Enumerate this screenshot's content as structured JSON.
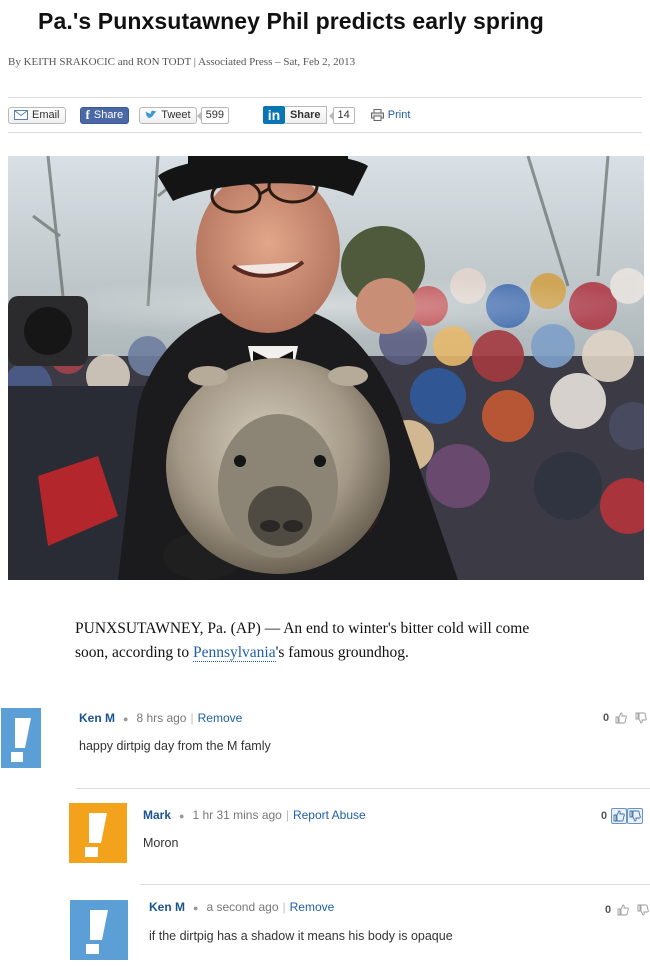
{
  "article": {
    "headline": "Pa.'s Punxsutawney Phil predicts early spring",
    "byline": "By KEITH SRAKOCIC and RON TODT | Associated Press – Sat, Feb 2, 2013",
    "lead_before": "PUNXSUTAWNEY, Pa. (AP) — An end to winter's bitter cold will come soon, according to ",
    "lead_link": "Pennsylvania",
    "lead_after": "'s famous groundhog."
  },
  "share": {
    "email_label": "Email",
    "facebook_label": "Share",
    "tweet_label": "Tweet",
    "tweet_count": "599",
    "linkedin_label": "Share",
    "linkedin_count": "14",
    "print_label": "Print"
  },
  "comments": [
    {
      "name": "Ken M",
      "time": "8 hrs ago",
      "action": "Remove",
      "body": "happy dirtpig day from the M famly",
      "votes": "0",
      "avatar_color": "#5b9fd6"
    },
    {
      "name": "Mark",
      "time": "1 hr 31 mins ago",
      "action": "Report Abuse",
      "body": "Moron",
      "votes": "0",
      "avatar_color": "#f3a21b"
    },
    {
      "name": "Ken M",
      "time": "a second ago",
      "action": "Remove",
      "body": "if the dirtpig has a shadow it means his body is opaque",
      "votes": "0",
      "avatar_color": "#5b9fd6"
    }
  ],
  "icons": [
    "email-icon",
    "facebook-icon",
    "twitter-icon",
    "linkedin-icon",
    "print-icon",
    "thumbs-up-icon",
    "thumbs-down-icon",
    "avatar-exclamation-icon"
  ]
}
